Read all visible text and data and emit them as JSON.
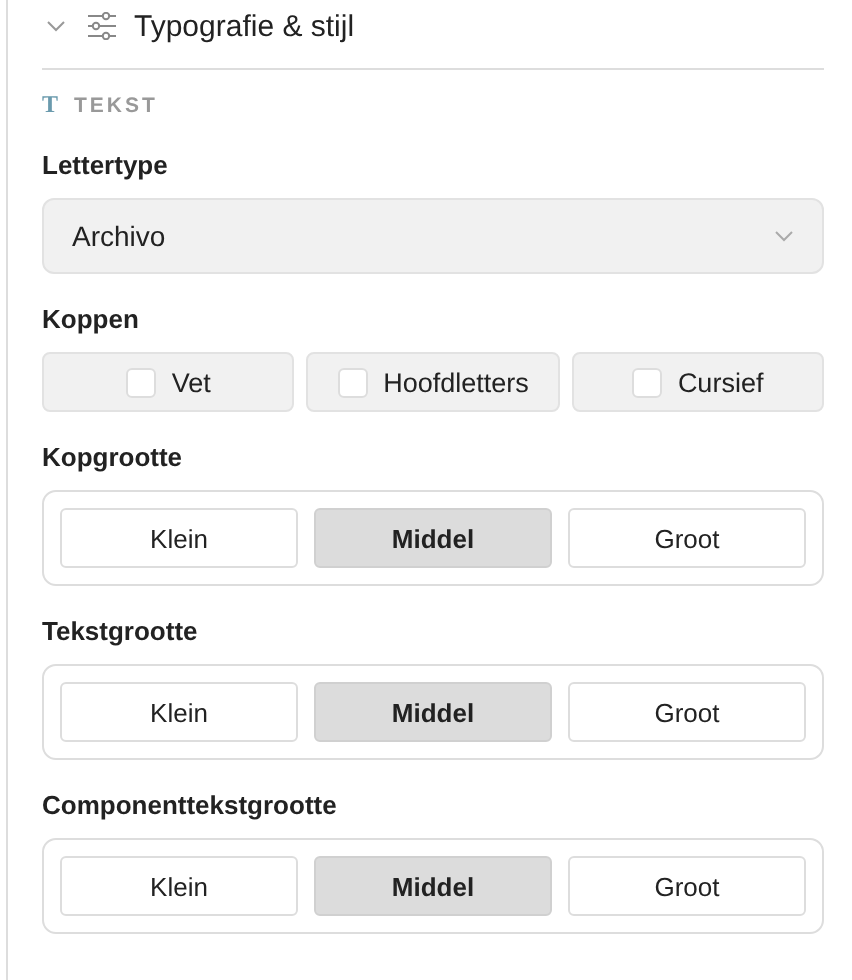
{
  "section": {
    "title": "Typografie & stijl",
    "expanded": true
  },
  "group_icon": "T",
  "group_label": "TEKST",
  "font": {
    "label": "Lettertype",
    "value": "Archivo"
  },
  "headings": {
    "label": "Koppen",
    "options": [
      {
        "label": "Vet",
        "checked": false
      },
      {
        "label": "Hoofdletters",
        "checked": false
      },
      {
        "label": "Cursief",
        "checked": false
      }
    ]
  },
  "sizes": [
    {
      "label": "Kopgrootte",
      "options": [
        {
          "label": "Klein",
          "selected": false
        },
        {
          "label": "Middel",
          "selected": true
        },
        {
          "label": "Groot",
          "selected": false
        }
      ]
    },
    {
      "label": "Tekstgrootte",
      "options": [
        {
          "label": "Klein",
          "selected": false
        },
        {
          "label": "Middel",
          "selected": true
        },
        {
          "label": "Groot",
          "selected": false
        }
      ]
    },
    {
      "label": "Componenttekstgrootte",
      "options": [
        {
          "label": "Klein",
          "selected": false
        },
        {
          "label": "Middel",
          "selected": true
        },
        {
          "label": "Groot",
          "selected": false
        }
      ]
    }
  ]
}
